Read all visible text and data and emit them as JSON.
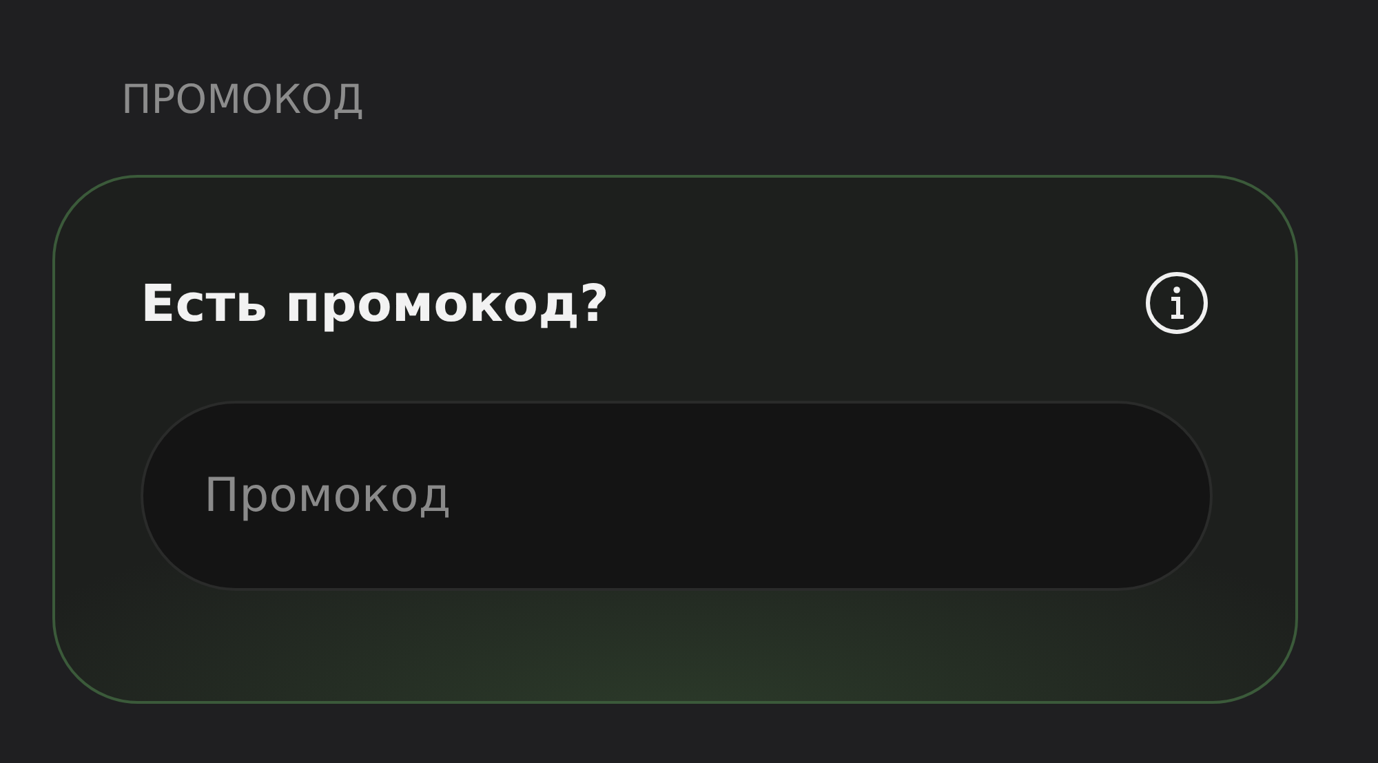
{
  "section_label": "ПРОМОКОД",
  "promo_card": {
    "title": "Есть промокод?",
    "input": {
      "placeholder": "Промокод"
    }
  }
}
